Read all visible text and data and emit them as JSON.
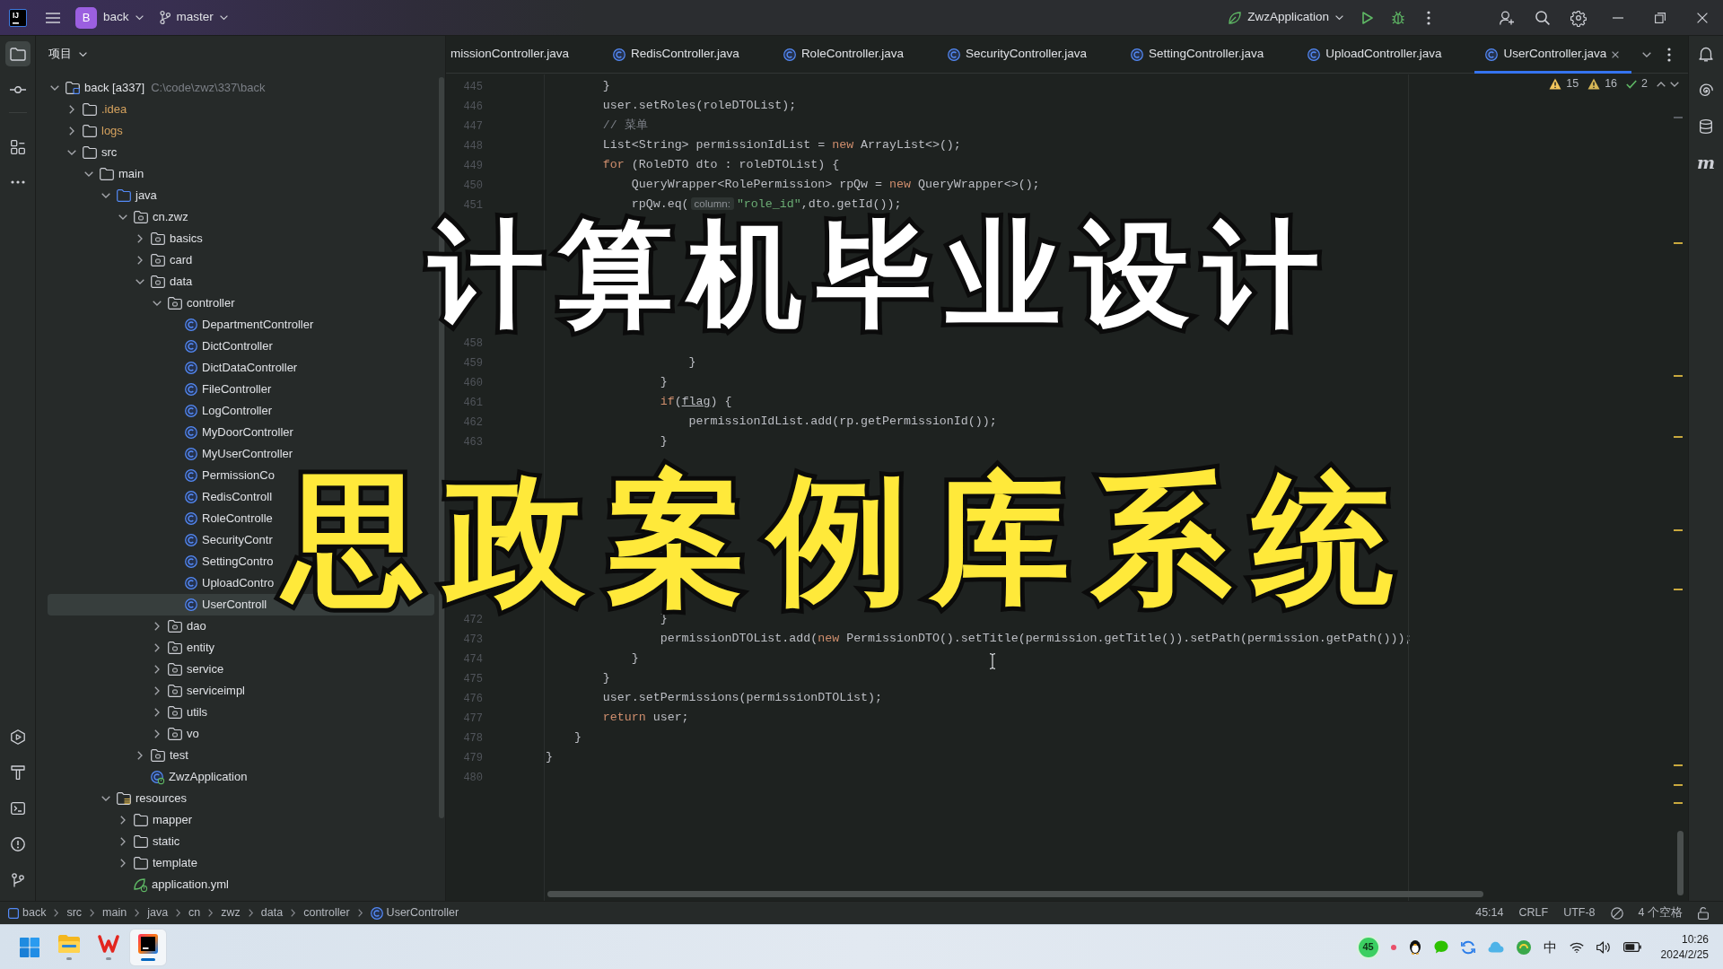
{
  "title_bar": {
    "app_logo": "IJ",
    "project_badge": "B",
    "project": "back",
    "branch": "master",
    "run_config": "ZwzApplication"
  },
  "left_toolbar": [
    {
      "selected": true
    },
    {
      "selected": false
    },
    {
      "selected": false
    }
  ],
  "project_panel": {
    "title": "项目",
    "tree": [
      {
        "label": "back [a337]",
        "path": "C:\\code\\zwz\\337\\back",
        "kind": "module",
        "expanded": true,
        "selected": false,
        "children": [
          {
            "label": ".idea",
            "kind": "excluded",
            "expanded": false,
            "selected": false
          },
          {
            "label": "logs",
            "kind": "excluded",
            "expanded": false,
            "selected": false
          },
          {
            "label": "src",
            "kind": "folder",
            "expanded": true,
            "selected": false,
            "children": [
              {
                "label": "main",
                "kind": "folder",
                "expanded": true,
                "selected": false,
                "children": [
                  {
                    "label": "java",
                    "kind": "source",
                    "expanded": true,
                    "selected": false,
                    "children": [
                      {
                        "label": "cn.zwz",
                        "kind": "package",
                        "expanded": true,
                        "selected": false,
                        "children": [
                          {
                            "label": "basics",
                            "kind": "package",
                            "expanded": false,
                            "selected": false
                          },
                          {
                            "label": "card",
                            "kind": "package",
                            "expanded": false,
                            "selected": false
                          },
                          {
                            "label": "data",
                            "kind": "package",
                            "expanded": true,
                            "selected": false,
                            "children": [
                              {
                                "label": "controller",
                                "kind": "package",
                                "expanded": true,
                                "selected": false,
                                "children": [
                                  {
                                    "label": "DepartmentController",
                                    "kind": "class",
                                    "selected": false
                                  },
                                  {
                                    "label": "DictController",
                                    "kind": "class",
                                    "selected": false
                                  },
                                  {
                                    "label": "DictDataController",
                                    "kind": "class",
                                    "selected": false
                                  },
                                  {
                                    "label": "FileController",
                                    "kind": "class",
                                    "selected": false
                                  },
                                  {
                                    "label": "LogController",
                                    "kind": "class",
                                    "selected": false
                                  },
                                  {
                                    "label": "MyDoorController",
                                    "kind": "class",
                                    "selected": false
                                  },
                                  {
                                    "label": "MyUserController",
                                    "kind": "class",
                                    "selected": false
                                  },
                                  {
                                    "label": "PermissionCo",
                                    "kind": "class",
                                    "selected": false
                                  },
                                  {
                                    "label": "RedisControll",
                                    "kind": "class",
                                    "selected": false
                                  },
                                  {
                                    "label": "RoleControlle",
                                    "kind": "class",
                                    "selected": false
                                  },
                                  {
                                    "label": "SecurityContr",
                                    "kind": "class",
                                    "selected": false
                                  },
                                  {
                                    "label": "SettingContro",
                                    "kind": "class",
                                    "selected": false
                                  },
                                  {
                                    "label": "UploadContro",
                                    "kind": "class",
                                    "selected": false
                                  },
                                  {
                                    "label": "UserControll",
                                    "kind": "class",
                                    "selected": true
                                  }
                                ]
                              },
                              {
                                "label": "dao",
                                "kind": "package",
                                "expanded": false,
                                "selected": false
                              },
                              {
                                "label": "entity",
                                "kind": "package",
                                "expanded": false,
                                "selected": false
                              },
                              {
                                "label": "service",
                                "kind": "package",
                                "expanded": false,
                                "selected": false
                              },
                              {
                                "label": "serviceimpl",
                                "kind": "package",
                                "expanded": false,
                                "selected": false
                              },
                              {
                                "label": "utils",
                                "kind": "package",
                                "expanded": false,
                                "selected": false
                              },
                              {
                                "label": "vo",
                                "kind": "package",
                                "expanded": false,
                                "selected": false
                              }
                            ]
                          },
                          {
                            "label": "test",
                            "kind": "package",
                            "expanded": false,
                            "selected": false
                          },
                          {
                            "label": "ZwzApplication",
                            "kind": "app-class",
                            "selected": false
                          }
                        ]
                      }
                    ]
                  },
                  {
                    "label": "resources",
                    "kind": "resources",
                    "expanded": true,
                    "selected": false,
                    "children": [
                      {
                        "label": "mapper",
                        "kind": "folder",
                        "expanded": false,
                        "selected": false
                      },
                      {
                        "label": "static",
                        "kind": "folder",
                        "expanded": false,
                        "selected": false
                      },
                      {
                        "label": "template",
                        "kind": "folder",
                        "expanded": false,
                        "selected": false
                      },
                      {
                        "label": "application.yml",
                        "kind": "config",
                        "selected": false
                      }
                    ]
                  }
                ]
              }
            ]
          }
        ]
      }
    ]
  },
  "editor": {
    "tabs": [
      {
        "label": "missionController.java",
        "kind": "clipped",
        "selected": false
      },
      {
        "label": "RedisController.java",
        "kind": "class",
        "selected": false
      },
      {
        "label": "RoleController.java",
        "kind": "class",
        "selected": false
      },
      {
        "label": "SecurityController.java",
        "kind": "class",
        "selected": false
      },
      {
        "label": "SettingController.java",
        "kind": "class",
        "selected": false
      },
      {
        "label": "UploadController.java",
        "kind": "class",
        "selected": false
      },
      {
        "label": "UserController.java",
        "kind": "class",
        "selected": true
      }
    ],
    "inspections": {
      "warnings": "15",
      "weak_warnings": "16",
      "typos": "2"
    },
    "lines": [
      {
        "kind": "code",
        "number": "445",
        "tokens": [
          {
            "kind": "plain",
            "text": "        }"
          }
        ]
      },
      {
        "kind": "code",
        "number": "446",
        "tokens": [
          {
            "kind": "plain",
            "text": "        user.setRoles(roleDTOList);"
          }
        ]
      },
      {
        "kind": "code",
        "number": "447",
        "tokens": [
          {
            "kind": "comment",
            "text": "        // 菜单"
          }
        ]
      },
      {
        "kind": "code",
        "number": "448",
        "tokens": [
          {
            "kind": "plain",
            "text": "        List<String> permissionIdList = "
          },
          {
            "kind": "keyword",
            "text": "new"
          },
          {
            "kind": "plain",
            "text": " ArrayList<>();"
          }
        ]
      },
      {
        "kind": "code",
        "number": "449",
        "tokens": [
          {
            "kind": "keyword",
            "text": "        for"
          },
          {
            "kind": "plain",
            "text": " (RoleDTO dto : roleDTOList) {"
          }
        ]
      },
      {
        "kind": "code",
        "number": "450",
        "tokens": [
          {
            "kind": "plain",
            "text": "            QueryWrapper<RolePermission> rpQw = "
          },
          {
            "kind": "keyword",
            "text": "new"
          },
          {
            "kind": "plain",
            "text": " QueryWrapper<>();"
          }
        ]
      },
      {
        "kind": "code",
        "number": "451",
        "tokens": [
          {
            "kind": "plain",
            "text": "            rpQw.eq("
          },
          {
            "kind": "hint",
            "text": "column:"
          },
          {
            "kind": "string",
            "text": "\"role_id\""
          },
          {
            "kind": "plain",
            "text": ",dto.getId());"
          }
        ]
      },
      {
        "kind": "covered"
      },
      {
        "kind": "covered"
      },
      {
        "kind": "covered"
      },
      {
        "kind": "covered"
      },
      {
        "kind": "covered"
      },
      {
        "kind": "covered"
      },
      {
        "kind": "code",
        "number": "458"
      },
      {
        "kind": "code",
        "number": "459",
        "tokens": [
          {
            "kind": "plain",
            "text": "                    }"
          }
        ]
      },
      {
        "kind": "code",
        "number": "460",
        "tokens": [
          {
            "kind": "plain",
            "text": "                }"
          }
        ]
      },
      {
        "kind": "code",
        "number": "461",
        "tokens": [
          {
            "kind": "keyword",
            "text": "                if"
          },
          {
            "kind": "plain",
            "text": "("
          },
          {
            "kind": "underlined",
            "text": "flag"
          },
          {
            "kind": "plain",
            "text": ") {"
          }
        ]
      },
      {
        "kind": "code",
        "number": "462",
        "tokens": [
          {
            "kind": "plain",
            "text": "                    permissionIdList.add(rp.getPermissionId());"
          }
        ]
      },
      {
        "kind": "code",
        "number": "463",
        "tokens": [
          {
            "kind": "plain",
            "text": "                }"
          }
        ]
      },
      {
        "kind": "covered"
      },
      {
        "kind": "covered"
      },
      {
        "kind": "covered"
      },
      {
        "kind": "covered"
      },
      {
        "kind": "covered"
      },
      {
        "kind": "covered"
      },
      {
        "kind": "covered"
      },
      {
        "kind": "covered"
      },
      {
        "kind": "code",
        "number": "472",
        "tokens": [
          {
            "kind": "plain",
            "text": "                }"
          }
        ]
      },
      {
        "kind": "code",
        "number": "473",
        "tokens": [
          {
            "kind": "plain",
            "text": "                permissionDTOList.add("
          },
          {
            "kind": "keyword",
            "text": "new"
          },
          {
            "kind": "plain",
            "text": " PermissionDTO().setTitle(permission.getTitle()).setPath(permission.getPath()));"
          }
        ]
      },
      {
        "kind": "code",
        "number": "474",
        "tokens": [
          {
            "kind": "plain",
            "text": "            }"
          }
        ]
      },
      {
        "kind": "code",
        "number": "475",
        "tokens": [
          {
            "kind": "plain",
            "text": "        }"
          }
        ]
      },
      {
        "kind": "code",
        "number": "476",
        "tokens": [
          {
            "kind": "plain",
            "text": "        user.setPermissions(permissionDTOList);"
          }
        ]
      },
      {
        "kind": "code",
        "number": "477",
        "tokens": [
          {
            "kind": "keyword",
            "text": "        return"
          },
          {
            "kind": "plain",
            "text": " user;"
          }
        ]
      },
      {
        "kind": "code",
        "number": "478",
        "tokens": [
          {
            "kind": "plain",
            "text": "    }"
          }
        ]
      },
      {
        "kind": "code",
        "number": "479",
        "tokens": [
          {
            "kind": "plain",
            "text": "}"
          }
        ]
      },
      {
        "kind": "code",
        "number": "480"
      }
    ]
  },
  "right_toolbar": {
    "letter": "m"
  },
  "status_bar": {
    "breadcrumbs": [
      {
        "label": "back",
        "kind": "module"
      },
      {
        "label": "src",
        "kind": "folder"
      },
      {
        "label": "main",
        "kind": "folder"
      },
      {
        "label": "java",
        "kind": "folder"
      },
      {
        "label": "cn",
        "kind": "folder"
      },
      {
        "label": "zwz",
        "kind": "folder"
      },
      {
        "label": "data",
        "kind": "folder"
      },
      {
        "label": "controller",
        "kind": "folder"
      },
      {
        "label": "UserController",
        "kind": "class"
      }
    ],
    "position": "45:14",
    "line_separator": "CRLF",
    "encoding": "UTF-8",
    "indent": "4 个空格"
  },
  "taskbar": {
    "apps": [
      {
        "active": false
      },
      {
        "active": false
      },
      {
        "active": true
      }
    ],
    "tray_counter": "45",
    "input_method": "中",
    "time": "10:26",
    "date": "2024/2/25"
  },
  "overlay_title": [
    {
      "text": "计算机毕业设计",
      "color": "#ffffff"
    },
    {
      "text": "思政案例库系统",
      "color": "#ffe93a"
    }
  ]
}
